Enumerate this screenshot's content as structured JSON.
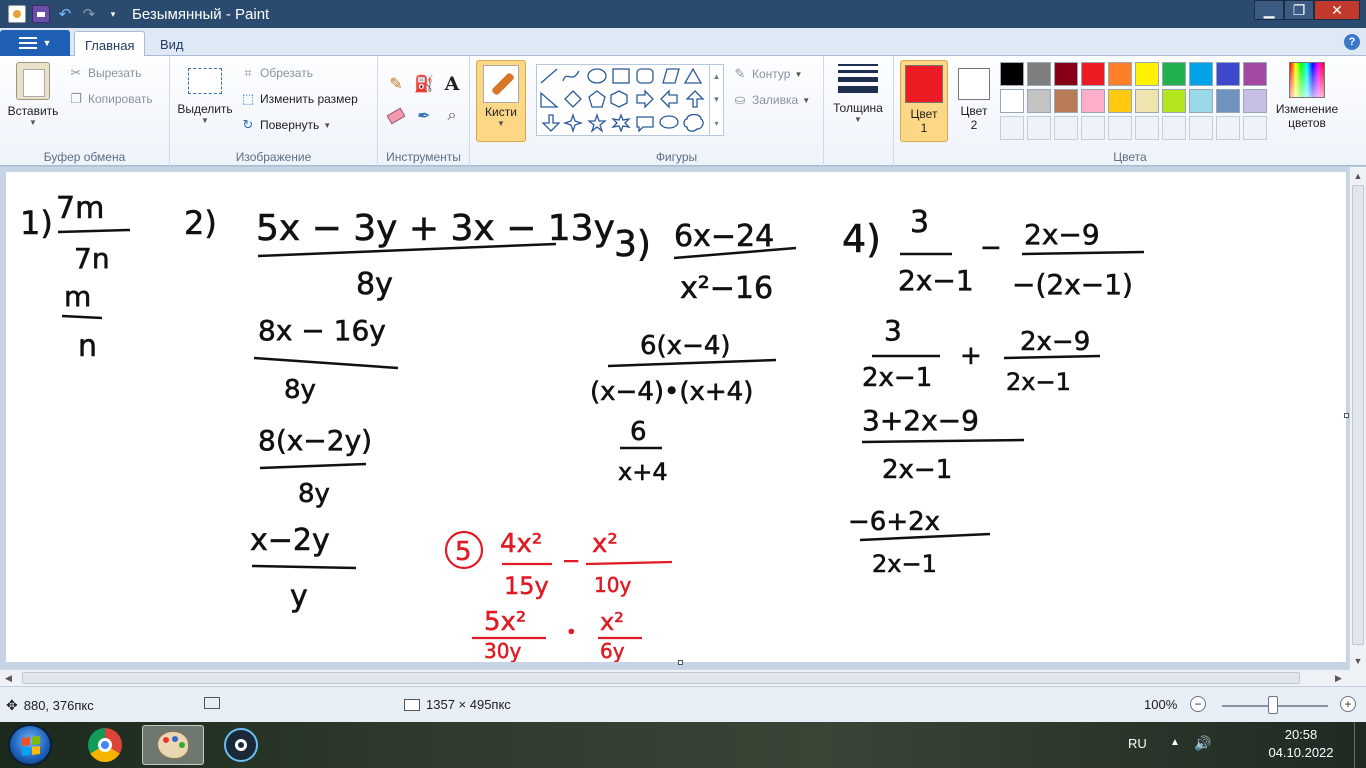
{
  "window": {
    "title": "Безымянный - Paint",
    "controls": {
      "minimize": "▁",
      "maximize": "❐",
      "close": "✕"
    }
  },
  "tabs": [
    {
      "label": "Главная",
      "active": true
    },
    {
      "label": "Вид",
      "active": false
    }
  ],
  "ribbon": {
    "clipboard": {
      "label": "Буфер обмена",
      "paste": "Вставить",
      "cut": "Вырезать",
      "copy": "Копировать"
    },
    "image": {
      "label": "Изображение",
      "select": "Выделить",
      "crop": "Обрезать",
      "resize": "Изменить размер",
      "rotate": "Повернуть"
    },
    "tools": {
      "label": "Инструменты"
    },
    "brushes": {
      "label": "Кисти"
    },
    "shapes": {
      "label": "Фигуры",
      "outline": "Контур",
      "fill": "Заливка"
    },
    "size": {
      "label": "Толщина"
    },
    "color1": {
      "label_line1": "Цвет",
      "label_line2": "1",
      "color": "#ed1c24"
    },
    "color2": {
      "label_line1": "Цвет",
      "label_line2": "2",
      "color": "#ffffff"
    },
    "colors": {
      "label": "Цвета",
      "edit_line1": "Изменение",
      "edit_line2": "цветов",
      "palette": [
        "#000000",
        "#7f7f7f",
        "#880015",
        "#ed1c24",
        "#ff7f27",
        "#fff200",
        "#22b14c",
        "#00a2e8",
        "#3f48cc",
        "#a349a4",
        "#ffffff",
        "#c3c3c3",
        "#b97a57",
        "#ffaec9",
        "#ffc90e",
        "#efe4b0",
        "#b5e61d",
        "#99d9ea",
        "#7092be",
        "#c8bfe7",
        "",
        "",
        "",
        "",
        "",
        "",
        "",
        "",
        "",
        ""
      ]
    }
  },
  "canvas": {
    "expressions": {
      "p1_num": "7m",
      "p1_den": "7n",
      "p1_res_num": "m",
      "p1_res_den": "n",
      "p1_label": "1)",
      "p2_label": "2)",
      "p2_num": "5x − 3y + 3x − 13y",
      "p2_den": "8y",
      "p2_s1_num": "8x − 16y",
      "p2_s1_den": "8y",
      "p2_s2_num": "8(x−2y)",
      "p2_s2_den": "8y",
      "p2_s3_num": "x−2y",
      "p2_s3_den": "y",
      "p3_label": "3)",
      "p3_num": "6x−24",
      "p3_den": "x²−16",
      "p3_s1_num": "6(x−4)",
      "p3_s1_den": "(x−4)•(x+4)",
      "p3_s2_num": "6",
      "p3_s2_den": "x+4",
      "p4_label": "4)",
      "p4_a_num": "3",
      "p4_a_den": "2x−1",
      "p4_op": "−",
      "p4_b_num": "2x−9",
      "p4_b_den": "−(2x−1)",
      "p4_s1_a_num": "3",
      "p4_s1_a_den": "2x−1",
      "p4_s1_op": "+",
      "p4_s1_b_num": "2x−9",
      "p4_s1_b_den": "2x−1",
      "p4_s2_num": "3+2x−9",
      "p4_s2_den": "2x−1",
      "p4_s3_num": "−6+2x",
      "p4_s3_den": "2x−1",
      "p5_label": "5",
      "p5_a_num": "4x²",
      "p5_a_den": "15y",
      "p5_op": "−",
      "p5_b_num": "x²",
      "p5_b_den": "10y",
      "p5_s1_a_num": "5x²",
      "p5_s1_a_den": "30y",
      "p5_s1_op": "•",
      "p5_s1_b_num": "x²",
      "p5_s1_b_den": "6y"
    }
  },
  "status": {
    "cursor_pos": "880, 376пкс",
    "image_size": "1357 × 495пкс",
    "zoom": "100%"
  },
  "taskbar": {
    "language": "RU",
    "time": "20:58",
    "date": "04.10.2022"
  }
}
